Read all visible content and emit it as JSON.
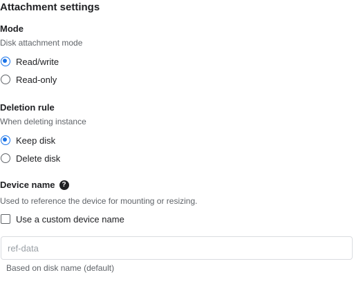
{
  "section_title": "Attachment settings",
  "mode": {
    "label": "Mode",
    "helper": "Disk attachment mode",
    "options": [
      {
        "label": "Read/write",
        "checked": true
      },
      {
        "label": "Read-only",
        "checked": false
      }
    ]
  },
  "deletion_rule": {
    "label": "Deletion rule",
    "helper": "When deleting instance",
    "options": [
      {
        "label": "Keep disk",
        "checked": true
      },
      {
        "label": "Delete disk",
        "checked": false
      }
    ]
  },
  "device_name": {
    "label": "Device name",
    "help_icon": "help-circle-icon",
    "helper": "Used to reference the device for mounting or resizing.",
    "custom_checkbox_label": "Use a custom device name",
    "custom_checked": false,
    "input_placeholder": "ref-data",
    "input_value": "",
    "input_hint": "Based on disk name (default)"
  },
  "colors": {
    "accent": "#1a73e8",
    "text": "#202124",
    "helper_text": "#5f6368",
    "border": "#dadce0"
  }
}
